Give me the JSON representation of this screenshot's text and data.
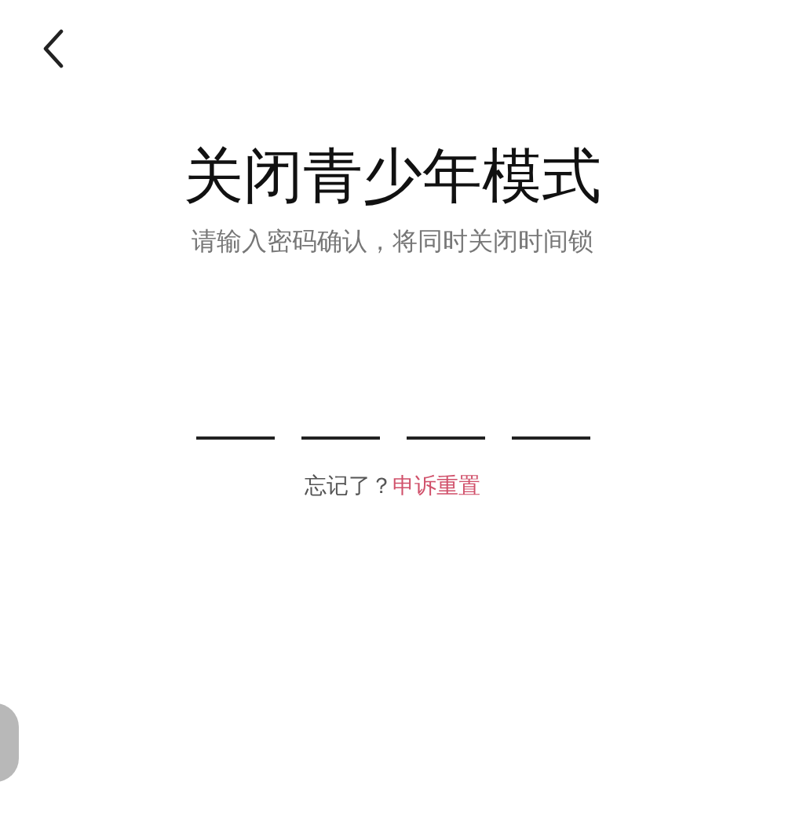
{
  "title": "关闭青少年模式",
  "subtitle": "请输入密码确认，将同时关闭时间锁",
  "pin_slots": [
    {
      "filled": false
    },
    {
      "filled": false
    },
    {
      "filled": false
    },
    {
      "filled": false
    }
  ],
  "forgot": {
    "prompt": "忘记了？",
    "link": "申诉重置"
  }
}
